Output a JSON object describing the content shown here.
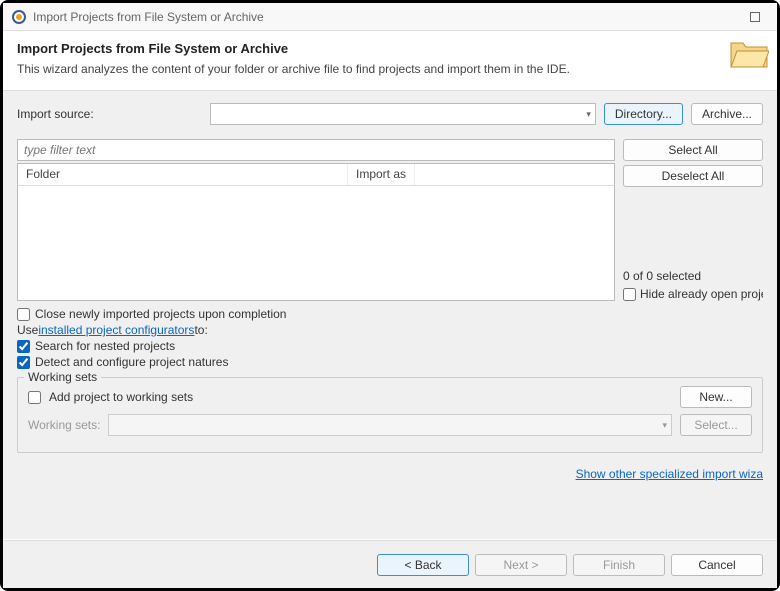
{
  "titlebar": {
    "title": "Import Projects from File System or Archive"
  },
  "header": {
    "title": "Import Projects from File System or Archive",
    "description": "This wizard analyzes the content of your folder or archive file to find projects and import them in the IDE."
  },
  "source": {
    "label": "Import source:",
    "value": "",
    "directory_btn": "Directory...",
    "archive_btn": "Archive..."
  },
  "table": {
    "filter_placeholder": "type filter text",
    "col_folder": "Folder",
    "col_import_as": "Import as",
    "select_all": "Select All",
    "deselect_all": "Deselect All",
    "status": "0 of 0 selected",
    "hide_open": "Hide already open projec"
  },
  "options": {
    "close_on_complete": "Close newly imported projects upon completion",
    "use_prefix": "Use ",
    "use_link": "installed project configurators",
    "use_suffix": " to:",
    "search_nested": "Search for nested projects",
    "detect_natures": "Detect and configure project natures"
  },
  "working_sets": {
    "legend": "Working sets",
    "add_label": "Add project to working sets",
    "new_btn": "New...",
    "ws_label": "Working sets:",
    "select_btn": "Select..."
  },
  "link": "Show other specialized import wiza",
  "footer": {
    "back": "< Back",
    "next": "Next >",
    "finish": "Finish",
    "cancel": "Cancel"
  }
}
